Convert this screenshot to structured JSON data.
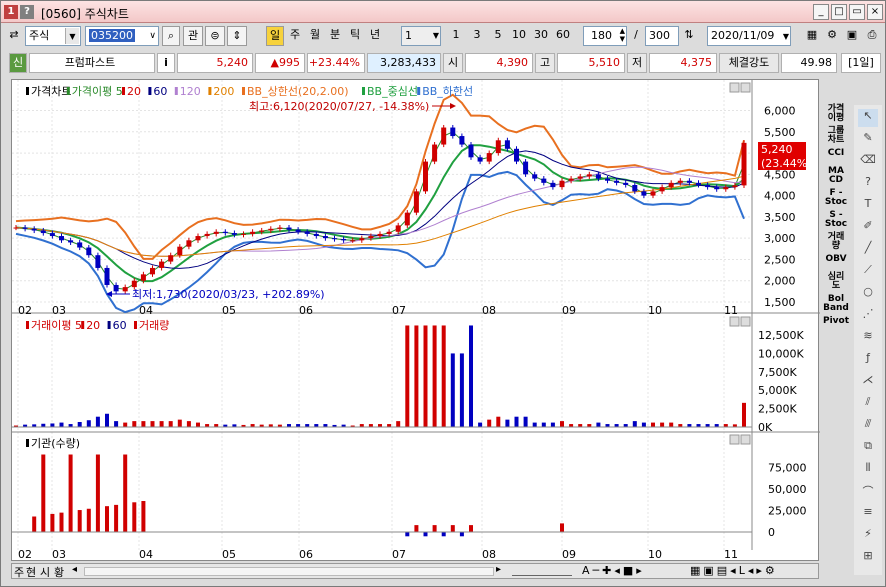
{
  "window": {
    "title": "[0560] 주식차트",
    "icon1": "1",
    "icon2": "?"
  },
  "toolbar": {
    "market": "주식",
    "code": "035200",
    "kwan": "관",
    "periods": [
      "일",
      "주",
      "월",
      "분",
      "틱",
      "년"
    ],
    "interval": "1",
    "quick": [
      "1",
      "3",
      "5",
      "10",
      "30",
      "60"
    ],
    "count": "180",
    "total": "300",
    "date": "2020/11/09"
  },
  "quote": {
    "tag": "신",
    "name": "프럼파스트",
    "info": "i",
    "price": "5,240",
    "change": "▲995",
    "pct": "+23.44%",
    "volume": "3,283,433",
    "open_label": "시",
    "open": "4,390",
    "high_label": "고",
    "high": "5,510",
    "low_label": "저",
    "low": "4,375",
    "strength_label": "체결강도",
    "strength": "49.98",
    "period": "[1일]"
  },
  "price_panel": {
    "legend": [
      "가격차트",
      "가격이평 5",
      "20",
      "60",
      "120",
      "200",
      "BB_상한선(20,2.00)",
      "BB_중심선",
      "BB_하한선"
    ],
    "annot_high": "최고:6,120(2020/07/27, -14.38%)",
    "annot_low": "최저:1,730(2020/03/23, +202.89%)",
    "ticks": [
      "6,000",
      "5,500",
      "5,000",
      "4,500",
      "4,000",
      "3,500",
      "3,000",
      "2,500",
      "2,000",
      "1,500"
    ],
    "last_price": "5,240",
    "last_pct": "(23.44%)"
  },
  "vol_panel": {
    "legend": [
      "거래이평 5",
      "20",
      "60",
      "거래량"
    ],
    "ticks": [
      "12,500K",
      "10,000K",
      "7,500K",
      "5,000K",
      "2,500K",
      "0K"
    ]
  },
  "inst_panel": {
    "legend": [
      "기관(수량)"
    ],
    "ticks": [
      "75,000",
      "50,000",
      "25,000",
      "0"
    ]
  },
  "months": [
    "02",
    "03",
    "04",
    "05",
    "06",
    "07",
    "08",
    "09",
    "10",
    "11"
  ],
  "right_labels": [
    "가격\n이평",
    "그룹\n차트",
    "CCI",
    "MA\nCD",
    "F -\nStoc",
    "S -\nStoc",
    "거래\n량",
    "OBV",
    "심리\n도",
    "Bol\nBand",
    "Pivot"
  ],
  "bottom_tabs": [
    "주",
    "현",
    "시",
    "황"
  ],
  "colors": {
    "ma5": "#2a8a2a",
    "ma20": "#d00000",
    "ma60": "#000080",
    "ma120": "#b080d0",
    "ma200": "#e08000",
    "bb_upper": "#e87020",
    "bb_mid": "#20a040",
    "bb_lower": "#3070d0",
    "up": "#d00000",
    "down": "#0000c0",
    "highlight": "#e00000"
  },
  "chart_data": {
    "type": "candlestick",
    "x_range": [
      "2020-02",
      "2020-11-09"
    ],
    "ylim": [
      1500,
      6200
    ],
    "high": {
      "value": 6120,
      "date": "2020/07/27"
    },
    "low": {
      "value": 1730,
      "date": "2020/03/23"
    },
    "last": 5240,
    "close_series": [
      3250,
      3220,
      3180,
      3120,
      3050,
      2950,
      2900,
      2780,
      2600,
      2300,
      1900,
      1750,
      1850,
      2000,
      2150,
      2300,
      2450,
      2600,
      2800,
      2950,
      3050,
      3100,
      3150,
      3120,
      3080,
      3100,
      3150,
      3180,
      3220,
      3250,
      3200,
      3150,
      3100,
      3050,
      3000,
      2980,
      2950,
      2950,
      3000,
      3050,
      3100,
      3150,
      3300,
      3600,
      4100,
      4800,
      5200,
      5600,
      5400,
      5200,
      4900,
      4800,
      5000,
      5300,
      5100,
      4800,
      4500,
      4400,
      4300,
      4200,
      4350,
      4400,
      4450,
      4500,
      4400,
      4350,
      4300,
      4250,
      4100,
      4000,
      4100,
      4200,
      4300,
      4350,
      4300,
      4250,
      4200,
      4150,
      4200,
      4240,
      5240
    ]
  }
}
